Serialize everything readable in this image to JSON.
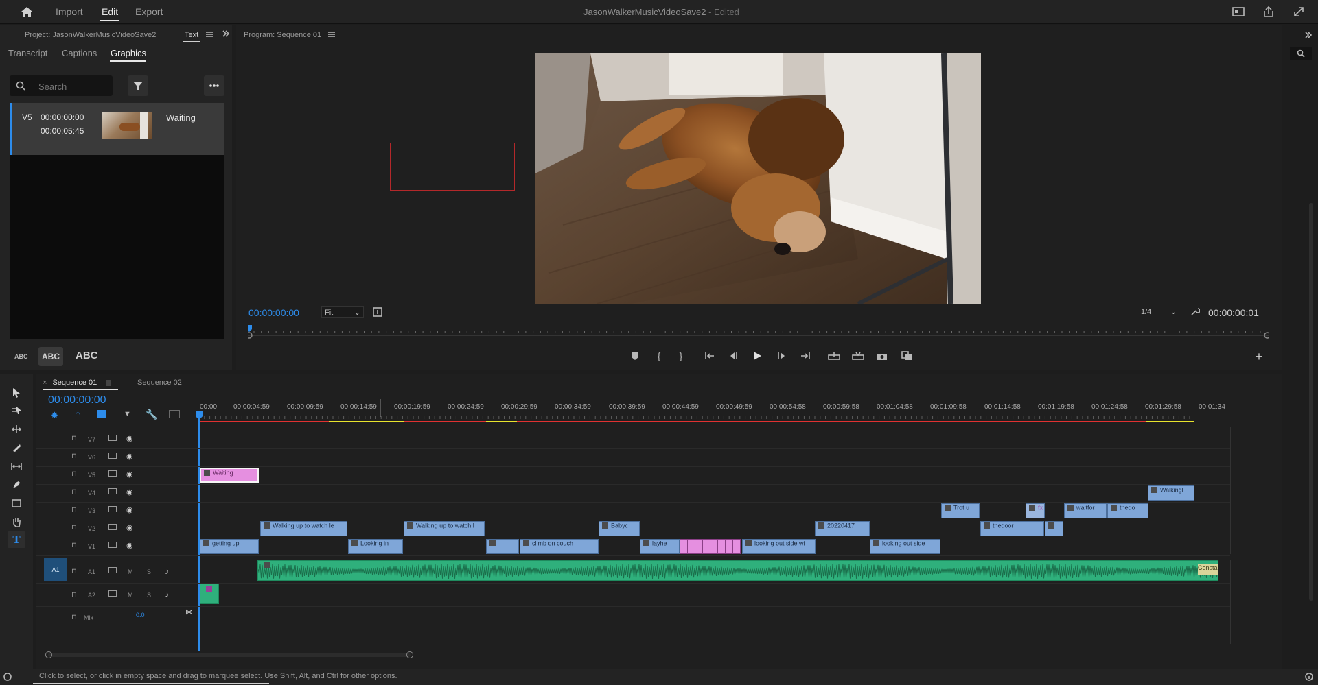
{
  "topbar": {
    "nav": [
      "Import",
      "Edit",
      "Export"
    ],
    "active_nav": "Edit",
    "project_title": "JasonWalkerMusicVideoSave2",
    "edit_state": "- Edited"
  },
  "project_panel": {
    "header": "Project: JasonWalkerMusicVideoSave2",
    "text_tab": "Text",
    "tabs": [
      "Transcript",
      "Captions",
      "Graphics"
    ],
    "active_tab": "Graphics",
    "search_placeholder": "Search",
    "item": {
      "track": "V5",
      "start": "00:00:00:00",
      "duration": "00:00:05:45",
      "name": "Waiting"
    },
    "text_sizes": [
      "ABC",
      "ABC",
      "ABC"
    ]
  },
  "program_monitor": {
    "title": "Program: Sequence 01",
    "timecode": "00:00:00:00",
    "fit": "Fit",
    "resolution": "1/4",
    "duration": "00:00:00:01"
  },
  "timeline": {
    "tabs": [
      "Sequence 01",
      "Sequence 02"
    ],
    "timecode": "00:00:00:00",
    "ruler": [
      "00:00",
      "00:00:04:59",
      "00:00:09:59",
      "00:00:14:59",
      "00:00:19:59",
      "00:00:24:59",
      "00:00:29:59",
      "00:00:34:59",
      "00:00:39:59",
      "00:00:44:59",
      "00:00:49:59",
      "00:00:54:58",
      "00:00:59:58",
      "00:01:04:58",
      "00:01:09:58",
      "00:01:14:58",
      "00:01:19:58",
      "00:01:24:58",
      "00:01:29:58",
      "00:01:34"
    ],
    "video_tracks": [
      "V7",
      "V6",
      "V5",
      "V4",
      "V3",
      "V2",
      "V1"
    ],
    "audio_tracks": [
      "A1",
      "A2"
    ],
    "audio_target": "A1",
    "mix_label": "Mix",
    "mix_value": "0.0",
    "mute_label": "M",
    "solo_label": "S",
    "clips": {
      "v5": [
        "Waiting"
      ],
      "v4": [
        "Walkingl"
      ],
      "v3": [
        "Trot u",
        "fx",
        "waitfor",
        "thedo"
      ],
      "v2": [
        "Walking up to watch le",
        "Walking up to watch l",
        "Babyc",
        "20220417_",
        "thedoor"
      ],
      "v1": [
        "getting up",
        "Looking in",
        "climb on couch",
        "layhe",
        "looking out side wi",
        "looking out side"
      ],
      "a1": [
        "Consta"
      ]
    },
    "meter_labels": [
      "S",
      "S"
    ]
  },
  "status": {
    "hint": "Click to select, or click in empty space and drag to marquee select. Use Shift, Alt, and Ctrl for other options."
  },
  "colors": {
    "accent": "#2d8ceb",
    "video_clip": "#7fa6d8",
    "graphic_clip": "#e58fe0",
    "audio_clip": "#29b37e"
  }
}
